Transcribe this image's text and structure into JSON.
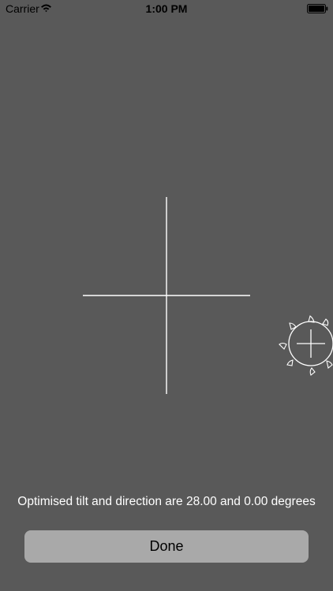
{
  "status_bar": {
    "carrier": "Carrier",
    "time": "1:00 PM",
    "icons": [
      "wifi-icon",
      "battery-icon"
    ]
  },
  "main": {
    "icons": [
      "crosshair-icon",
      "sun-icon"
    ],
    "message": "Optimised tilt and direction are 28.00 and 0.00 degrees",
    "done_label": "Done"
  },
  "colors": {
    "background": "#595959",
    "button": "#a9a9a9",
    "lines": "#ffffff",
    "text": "#ffffff"
  }
}
